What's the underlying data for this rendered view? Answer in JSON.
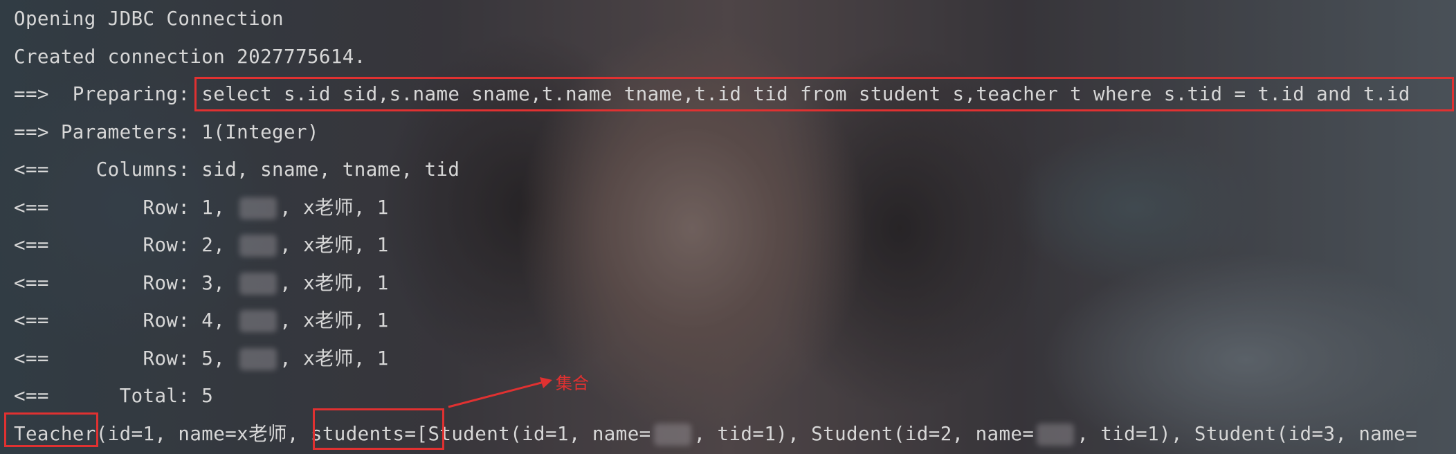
{
  "console": {
    "lines": [
      {
        "parts": [
          "Opening JDBC Connection"
        ]
      },
      {
        "parts": [
          "Created connection 2027775614."
        ]
      },
      {
        "parts": [
          "==>  Preparing: ",
          "select s.id sid,s.name sname,t.name tname,t.id tid from student s,teacher t where s.tid = t.id and t.id"
        ]
      },
      {
        "parts": [
          "==> Parameters: 1(Integer)"
        ]
      },
      {
        "parts": [
          "<==    Columns: sid, sname, tname, tid"
        ]
      },
      {
        "parts": [
          "<==        Row: 1, ",
          ", x老师, 1"
        ]
      },
      {
        "parts": [
          "<==        Row: 2, ",
          ", x老师, 1"
        ]
      },
      {
        "parts": [
          "<==        Row: 3, ",
          ", x老师, 1"
        ]
      },
      {
        "parts": [
          "<==        Row: 4, ",
          ", x老师, 1"
        ]
      },
      {
        "parts": [
          "<==        Row: 5, ",
          ", x老师, 1"
        ]
      },
      {
        "parts": [
          "<==      Total: 5"
        ]
      },
      {
        "parts": [
          "Teacher",
          "(id=1, name=x老师, ",
          "students=[",
          "Student(id=1, name=",
          ", tid=1), Student(id=2, name=",
          ", tid=1), Student(id=3, name=",
          ""
        ]
      }
    ]
  },
  "annotation": {
    "label": "集合"
  },
  "colors": {
    "highlight": "#e03131",
    "text": "#d7d7d7"
  }
}
